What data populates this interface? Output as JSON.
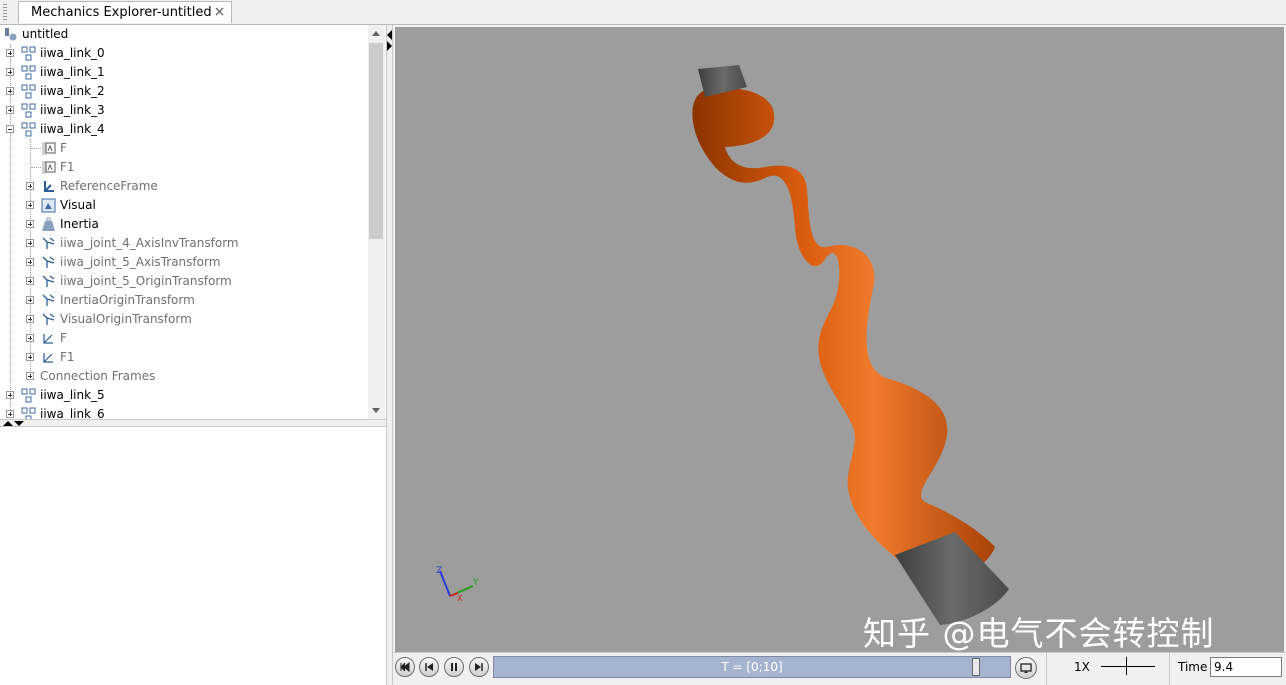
{
  "tab": {
    "title": "Mechanics Explorer-untitled"
  },
  "tree": {
    "root": "untitled",
    "items": [
      {
        "label": "iiwa_link_0"
      },
      {
        "label": "iiwa_link_1"
      },
      {
        "label": "iiwa_link_2"
      },
      {
        "label": "iiwa_link_3"
      },
      {
        "label": "iiwa_link_4"
      },
      {
        "label": "F"
      },
      {
        "label": "F1"
      },
      {
        "label": "ReferenceFrame"
      },
      {
        "label": "Visual"
      },
      {
        "label": "Inertia"
      },
      {
        "label": "iiwa_joint_4_AxisInvTransform"
      },
      {
        "label": "iiwa_joint_5_AxisTransform"
      },
      {
        "label": "iiwa_joint_5_OriginTransform"
      },
      {
        "label": "InertiaOriginTransform"
      },
      {
        "label": "VisualOriginTransform"
      },
      {
        "label": "F"
      },
      {
        "label": "F1"
      },
      {
        "label": "Connection Frames"
      },
      {
        "label": "iiwa_link_5"
      },
      {
        "label": "iiwa_link_6"
      }
    ]
  },
  "viewport": {
    "triad": {
      "x": "X",
      "y": "Y",
      "z": "Z"
    },
    "watermark": "知乎 @电气不会转控制",
    "background": "#9d9d9d",
    "robot_color": "#e0620f"
  },
  "controls": {
    "timeline_label": "T = [0;10]",
    "timeline_progress": 0.94,
    "speed": "1X",
    "time_label": "Time",
    "time_value": "9.4"
  }
}
